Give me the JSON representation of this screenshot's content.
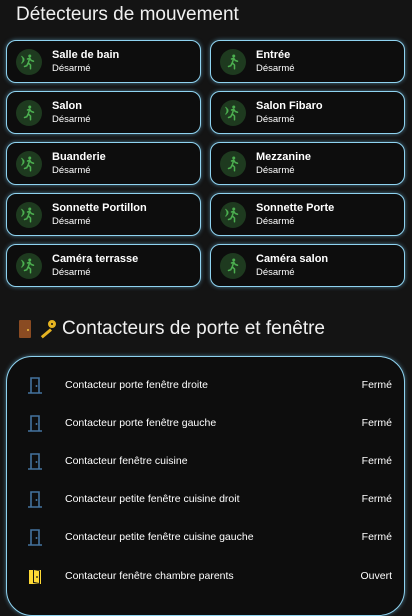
{
  "motion": {
    "title": "Détecteurs de mouvement",
    "sensors": [
      {
        "name": "Salle de bain",
        "state": "Désarmé",
        "icon": "motion-sensor-icon"
      },
      {
        "name": "Entrée",
        "state": "Désarmé",
        "icon": "walk-icon"
      },
      {
        "name": "Salon",
        "state": "Désarmé",
        "icon": "walk-icon"
      },
      {
        "name": "Salon Fibaro",
        "state": "Désarmé",
        "icon": "motion-sensor-icon"
      },
      {
        "name": "Buanderie",
        "state": "Désarmé",
        "icon": "motion-sensor-icon"
      },
      {
        "name": "Mezzanine",
        "state": "Désarmé",
        "icon": "walk-icon"
      },
      {
        "name": "Sonnette Portillon",
        "state": "Désarmé",
        "icon": "motion-sensor-icon"
      },
      {
        "name": "Sonnette Porte",
        "state": "Désarmé",
        "icon": "motion-sensor-icon"
      },
      {
        "name": "Caméra terrasse",
        "state": "Désarmé",
        "icon": "motion-sensor-icon"
      },
      {
        "name": "Caméra salon",
        "state": "Désarmé",
        "icon": "walk-icon"
      }
    ]
  },
  "contacts": {
    "title": "Contacteurs de porte et fenêtre",
    "icons": [
      "door-emoji-icon",
      "key-emoji-icon"
    ],
    "items": [
      {
        "name": "Contacteur porte fenêtre droite",
        "state": "Fermé",
        "icon": "door-closed-icon"
      },
      {
        "name": "Contacteur porte fenêtre gauche",
        "state": "Fermé",
        "icon": "door-closed-icon"
      },
      {
        "name": "Contacteur fenêtre cuisine",
        "state": "Fermé",
        "icon": "door-closed-icon"
      },
      {
        "name": "Contacteur petite fenêtre cuisine droit",
        "state": "Fermé",
        "icon": "door-closed-icon"
      },
      {
        "name": "Contacteur petite fenêtre cuisine gauche",
        "state": "Fermé",
        "icon": "door-closed-icon"
      },
      {
        "name": "Contacteur fenêtre chambre parents",
        "state": "Ouvert",
        "icon": "door-open-icon"
      }
    ]
  },
  "colors": {
    "background": "#141414",
    "card_border": "#8fd3f0",
    "motion_icon": "#4caf50",
    "motion_icon_bg": "#1e3a1f",
    "door_closed": "#44739e",
    "door_open": "#fdd835"
  }
}
